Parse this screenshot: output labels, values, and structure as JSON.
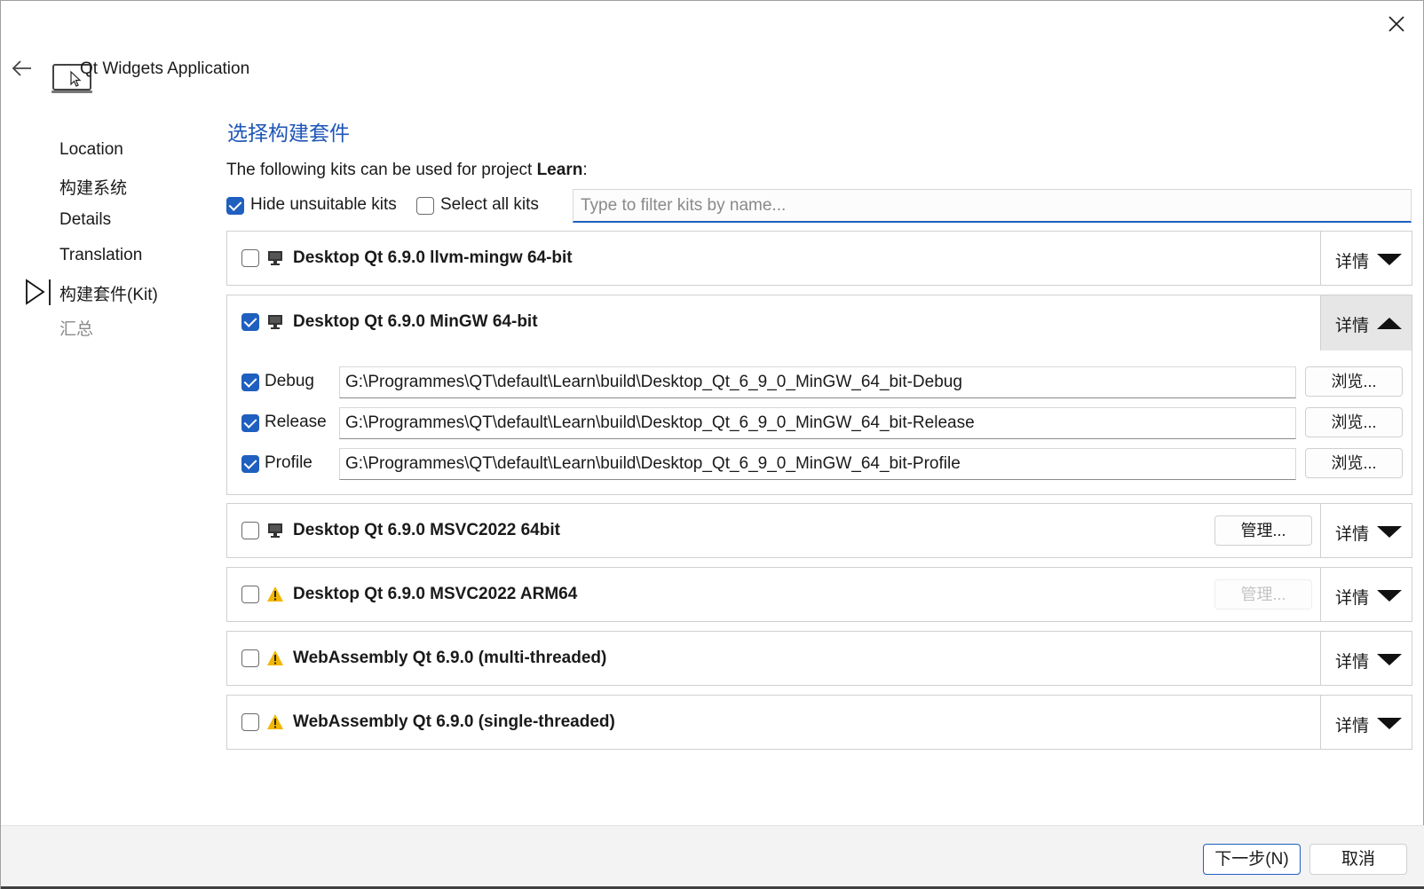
{
  "window": {
    "title": "Qt Widgets Application"
  },
  "steps": [
    {
      "label": "Location",
      "state": "done"
    },
    {
      "label": "构建系统",
      "state": "done"
    },
    {
      "label": "Details",
      "state": "done"
    },
    {
      "label": "Translation",
      "state": "done"
    },
    {
      "label": "构建套件(Kit)",
      "state": "current"
    },
    {
      "label": "汇总",
      "state": "pending"
    }
  ],
  "page": {
    "title": "选择构建套件",
    "description_prefix": "The following kits can be used for project ",
    "project_name": "Learn",
    "description_suffix": ":"
  },
  "options": {
    "hide_unsuitable": {
      "label": "Hide unsuitable kits",
      "checked": true
    },
    "select_all": {
      "label": "Select all kits",
      "checked": false
    }
  },
  "filter": {
    "placeholder": "Type to filter kits by name...",
    "value": ""
  },
  "details_label": "详情",
  "browse_label": "浏览...",
  "manage_label": "管理...",
  "kits": [
    {
      "name": "Desktop Qt 6.9.0 llvm-mingw 64-bit",
      "checked": false,
      "icon": "monitor-icon",
      "expanded": false
    },
    {
      "name": "Desktop Qt 6.9.0 MinGW 64-bit",
      "checked": true,
      "icon": "monitor-icon",
      "expanded": true,
      "configs": [
        {
          "label": "Debug",
          "checked": true,
          "path": "G:\\Programmes\\QT\\default\\Learn\\build\\Desktop_Qt_6_9_0_MinGW_64_bit-Debug"
        },
        {
          "label": "Release",
          "checked": true,
          "path": "G:\\Programmes\\QT\\default\\Learn\\build\\Desktop_Qt_6_9_0_MinGW_64_bit-Release"
        },
        {
          "label": "Profile",
          "checked": true,
          "path": "G:\\Programmes\\QT\\default\\Learn\\build\\Desktop_Qt_6_9_0_MinGW_64_bit-Profile"
        }
      ]
    },
    {
      "name": "Desktop Qt 6.9.0 MSVC2022 64bit",
      "checked": false,
      "icon": "monitor-icon",
      "expanded": false,
      "manage_enabled": true
    },
    {
      "name": "Desktop Qt 6.9.0 MSVC2022 ARM64",
      "checked": false,
      "icon": "warning-icon",
      "expanded": false,
      "manage_enabled": false
    },
    {
      "name": "WebAssembly Qt 6.9.0 (multi-threaded)",
      "checked": false,
      "icon": "warning-icon",
      "expanded": false
    },
    {
      "name": "WebAssembly Qt 6.9.0 (single-threaded)",
      "checked": false,
      "icon": "warning-icon",
      "expanded": false
    }
  ],
  "footer": {
    "next_label": "下一步(N)",
    "cancel_label": "取消"
  },
  "colors": {
    "accent": "#1f5fbf",
    "title_blue": "#1e56b8",
    "warning": "#f2b600"
  }
}
